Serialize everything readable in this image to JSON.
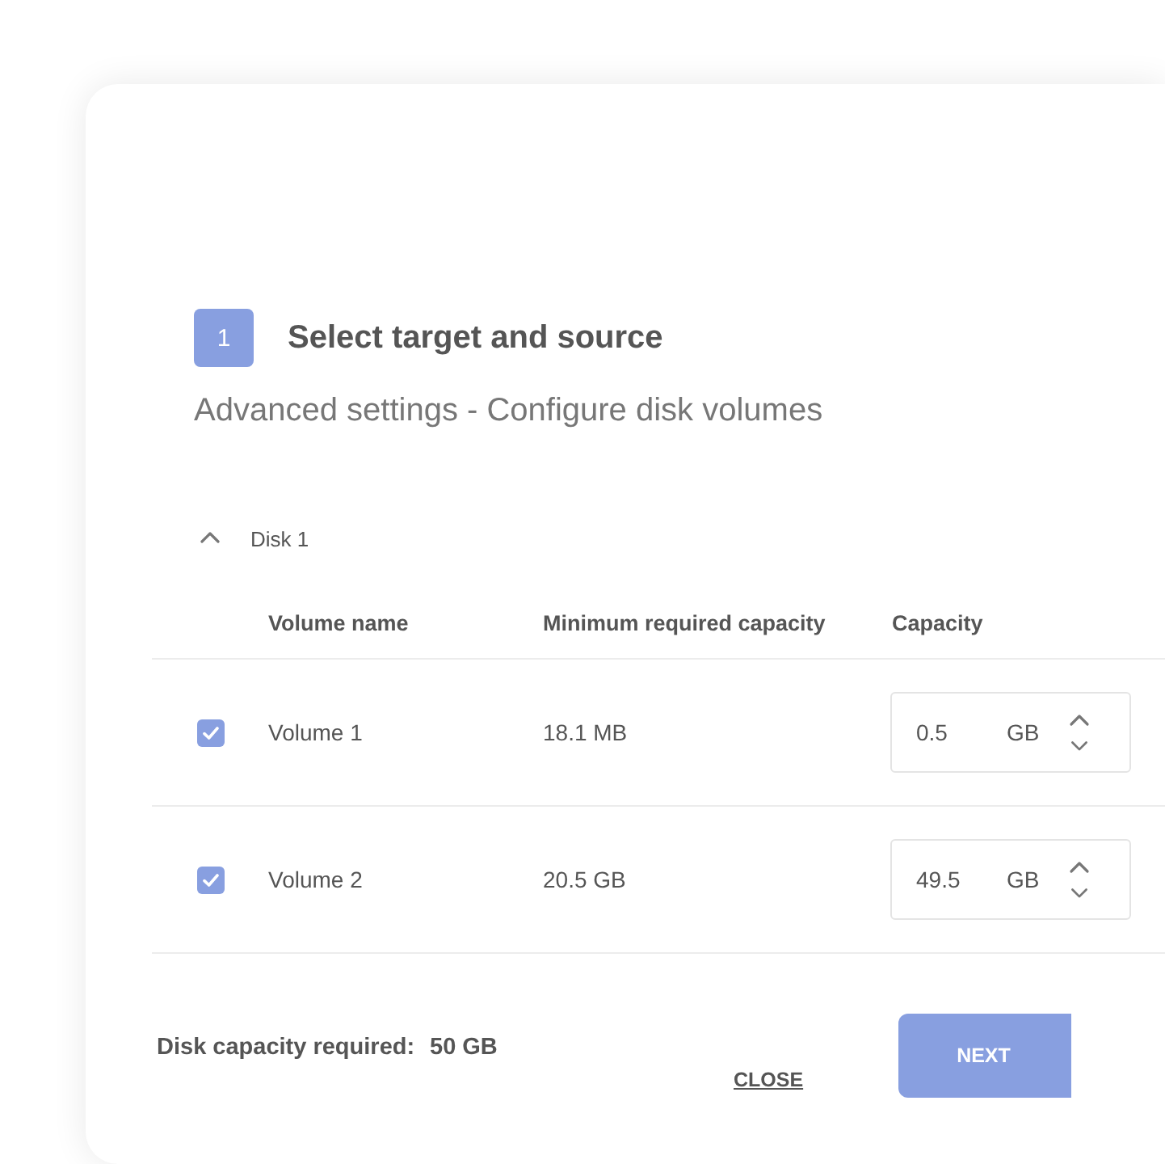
{
  "step": {
    "number": "1",
    "title": "Select target and source"
  },
  "subtitle": "Advanced settings - Configure disk volumes",
  "disk": {
    "label": "Disk 1",
    "expanded": true
  },
  "table": {
    "columns": [
      "Volume name",
      "Minimum required capacity",
      "Capacity"
    ],
    "rows": [
      {
        "checked": true,
        "name": "Volume 1",
        "min": "18.1 MB",
        "capacity": "0.5",
        "unit": "GB"
      },
      {
        "checked": true,
        "name": "Volume 2",
        "min": "20.5 GB",
        "capacity": "49.5",
        "unit": "GB"
      }
    ]
  },
  "footer": {
    "label": "Disk capacity required:",
    "value": "50 GB"
  },
  "buttons": [
    {
      "kind": "text",
      "label": "CLOSE"
    },
    {
      "kind": "primary",
      "label": "NEXT"
    }
  ]
}
